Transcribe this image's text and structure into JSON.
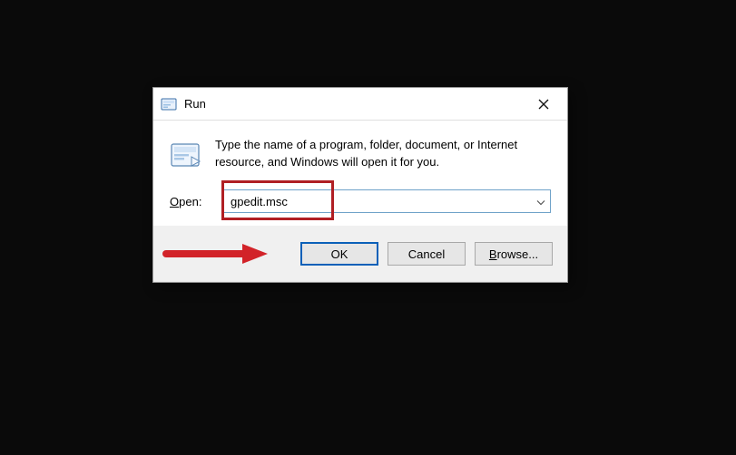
{
  "dialog": {
    "title": "Run",
    "description": "Type the name of a program, folder, document, or Internet resource, and Windows will open it for you.",
    "open_label": "Open:",
    "input_value": "gpedit.msc"
  },
  "buttons": {
    "ok": "OK",
    "cancel": "Cancel",
    "browse": "Browse..."
  },
  "annotations": {
    "highlight_color": "#b01f24",
    "arrow_color": "#d22329"
  }
}
